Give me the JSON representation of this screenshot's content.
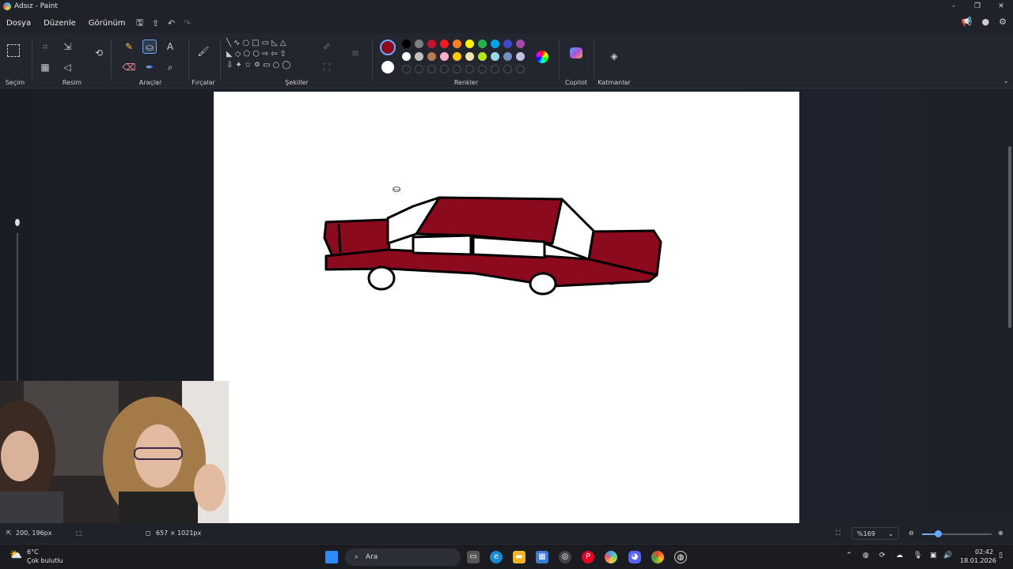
{
  "window": {
    "title": "Adsız - Paint",
    "controls": [
      "–",
      "❐",
      "✕"
    ]
  },
  "menu": {
    "items": [
      "Dosya",
      "Düzenle",
      "Görünüm"
    ]
  },
  "ribbon": {
    "groups": {
      "selection": "Seçim",
      "image": "Resim",
      "tools": "Araçlar",
      "brushes": "Fırçalar",
      "shapes": "Şekiller",
      "colors": "Renkler",
      "copilot": "Copilot",
      "layers": "Katmanlar"
    },
    "palette_row1": [
      "#000000",
      "#7f7f7f",
      "#c3122f",
      "#ed1c24",
      "#ff7f27",
      "#fff200",
      "#22b14c",
      "#00a2e8",
      "#3f48cc",
      "#a349a4"
    ],
    "palette_row2": [
      "#ffffff",
      "#c3c3c3",
      "#b97a57",
      "#ffaec9",
      "#ffc90e",
      "#efe4b0",
      "#b5e61d",
      "#99d9ea",
      "#7092be",
      "#c8bfe7"
    ],
    "primary_color": "#8b0a1e",
    "secondary_color": "#ffffff"
  },
  "status": {
    "cursor_pos": "200, 196px",
    "canvas_size": "657 × 1021px",
    "zoom": "%169"
  },
  "taskbar": {
    "weather_temp": "6°C",
    "weather_desc": "Çok bulutlu",
    "search_placeholder": "Ara",
    "time": "02:42",
    "date": "18.01.2026"
  },
  "drawing": {
    "car_color": "#8b0a1e"
  }
}
